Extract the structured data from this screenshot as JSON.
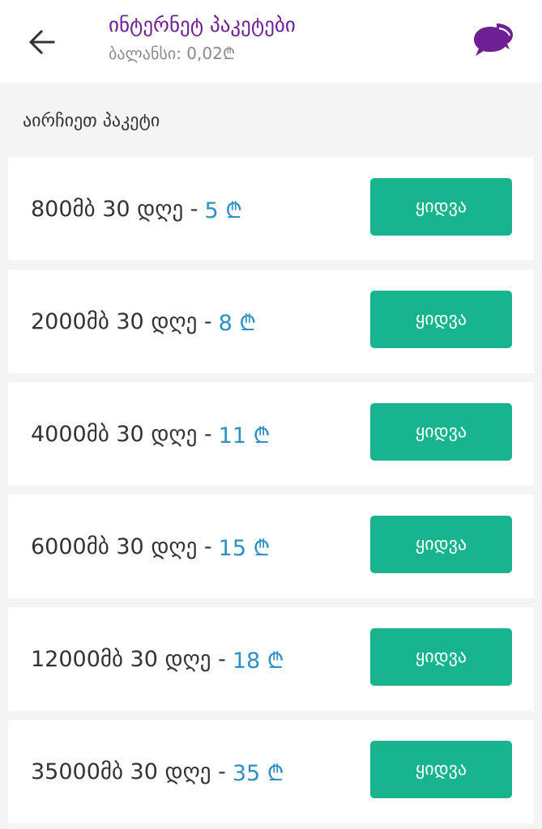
{
  "header": {
    "title": "ინტერნეტ პაკეტები",
    "balance": "ბალანსი: 0,02₾",
    "back_icon": "arrow-left-icon",
    "chat_icon": "chat-bubbles-icon"
  },
  "section_label": "აირჩიეთ პაკეტი",
  "colors": {
    "accent": "#6d1f93",
    "button": "#17b48f",
    "price": "#2d8fc7"
  },
  "packages": [
    {
      "desc": "800მბ 30 დღე -",
      "price": "5 ₾",
      "buy_label": "ყიდვა"
    },
    {
      "desc": "2000მბ 30 დღე -",
      "price": "8 ₾",
      "buy_label": "ყიდვა"
    },
    {
      "desc": "4000მბ 30 დღე -",
      "price": "11 ₾",
      "buy_label": "ყიდვა"
    },
    {
      "desc": "6000მბ 30 დღე -",
      "price": "15 ₾",
      "buy_label": "ყიდვა"
    },
    {
      "desc": "12000მბ 30 დღე -",
      "price": "18 ₾",
      "buy_label": "ყიდვა"
    },
    {
      "desc": "35000მბ 30 დღე -",
      "price": "35 ₾",
      "buy_label": "ყიდვა"
    }
  ]
}
